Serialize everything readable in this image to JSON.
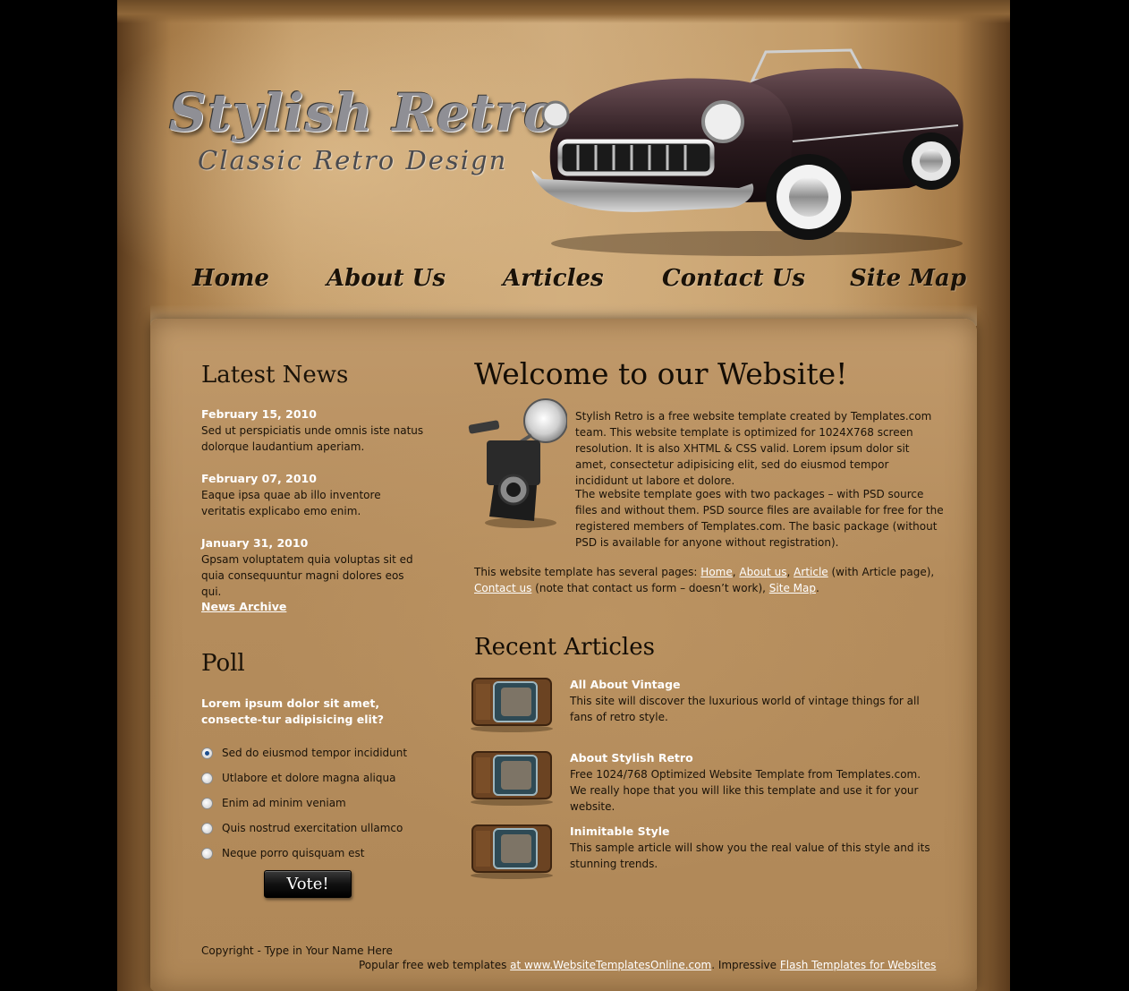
{
  "logo": {
    "title": "Stylish Retro",
    "subtitle": "Classic Retro Design"
  },
  "nav": {
    "items": [
      {
        "label": "Home"
      },
      {
        "label": "About Us"
      },
      {
        "label": "Articles"
      },
      {
        "label": "Contact Us"
      },
      {
        "label": "Site Map"
      }
    ]
  },
  "latest_news": {
    "heading": "Latest News",
    "items": [
      {
        "date": "February 15, 2010",
        "text": "Sed ut perspiciatis unde omnis iste natus dolorque laudantium aperiam."
      },
      {
        "date": "February 07, 2010",
        "text": "Eaque ipsa quae ab illo inventore veritatis explicabo emo enim."
      },
      {
        "date": "January 31, 2010",
        "text": "Gpsam voluptatem quia voluptas sit ed quia consequuntur magni dolores eos qui."
      }
    ],
    "archive_label": "News Archive"
  },
  "poll": {
    "heading": "Poll",
    "question": "Lorem ipsum dolor sit amet, consecte-tur adipisicing elit?",
    "options": [
      {
        "label": "Sed do eiusmod tempor incididunt",
        "selected": true
      },
      {
        "label": "Utlabore et dolore magna aliqua",
        "selected": false
      },
      {
        "label": "Enim ad minim veniam",
        "selected": false
      },
      {
        "label": "Quis nostrud exercitation ullamco",
        "selected": false
      },
      {
        "label": "Neque porro quisquam est",
        "selected": false
      }
    ],
    "vote_label": "Vote!"
  },
  "welcome": {
    "title": "Welcome to our Website!",
    "para1": "Stylish Retro is a free website template created by Templates.com team. This website template is optimized for 1024X768 screen resolution. It is also XHTML & CSS valid. Lorem ipsum dolor sit amet, consectetur adipisicing elit, sed do eiusmod tempor incididunt ut labore et dolore.",
    "para2": "The website template goes with two packages – with PSD source files and without them. PSD source files are available for free for the registered members of Templates.com. The basic package (without PSD is available for anyone without registration).",
    "para3_intro": "This website template has several pages: ",
    "links": {
      "home": "Home",
      "about": "About us",
      "article": "Article",
      "article_note": " (with Article page), ",
      "contact": "Contact us",
      "contact_note": " (note that contact us form – doesn’t work), ",
      "sitemap": "Site Map",
      "end": "."
    }
  },
  "recent_articles": {
    "heading": "Recent Articles",
    "items": [
      {
        "title": "All About Vintage",
        "text": "This site will discover the luxurious world of vintage things for all fans of retro style."
      },
      {
        "title": "About Stylish Retro",
        "text": "Free 1024/768 Optimized Website Template from Templates.com. We really hope that you will like this template and use it for your website."
      },
      {
        "title": "Inimitable Style",
        "text": "This sample article will show you the real value of this style and its stunning trends."
      }
    ]
  },
  "footer": {
    "copyright": "Copyright - Type in Your Name Here",
    "popular_prefix": "Popular free web templates ",
    "link1": "at www.WebsiteTemplatesOnline.com",
    "middle": ". Impressive ",
    "link2": "Flash Templates for Websites"
  },
  "colors": {
    "paper": "#b48c5c",
    "dark_text": "#1a1208",
    "accent_white": "#ffffff",
    "outer": "#000000"
  }
}
